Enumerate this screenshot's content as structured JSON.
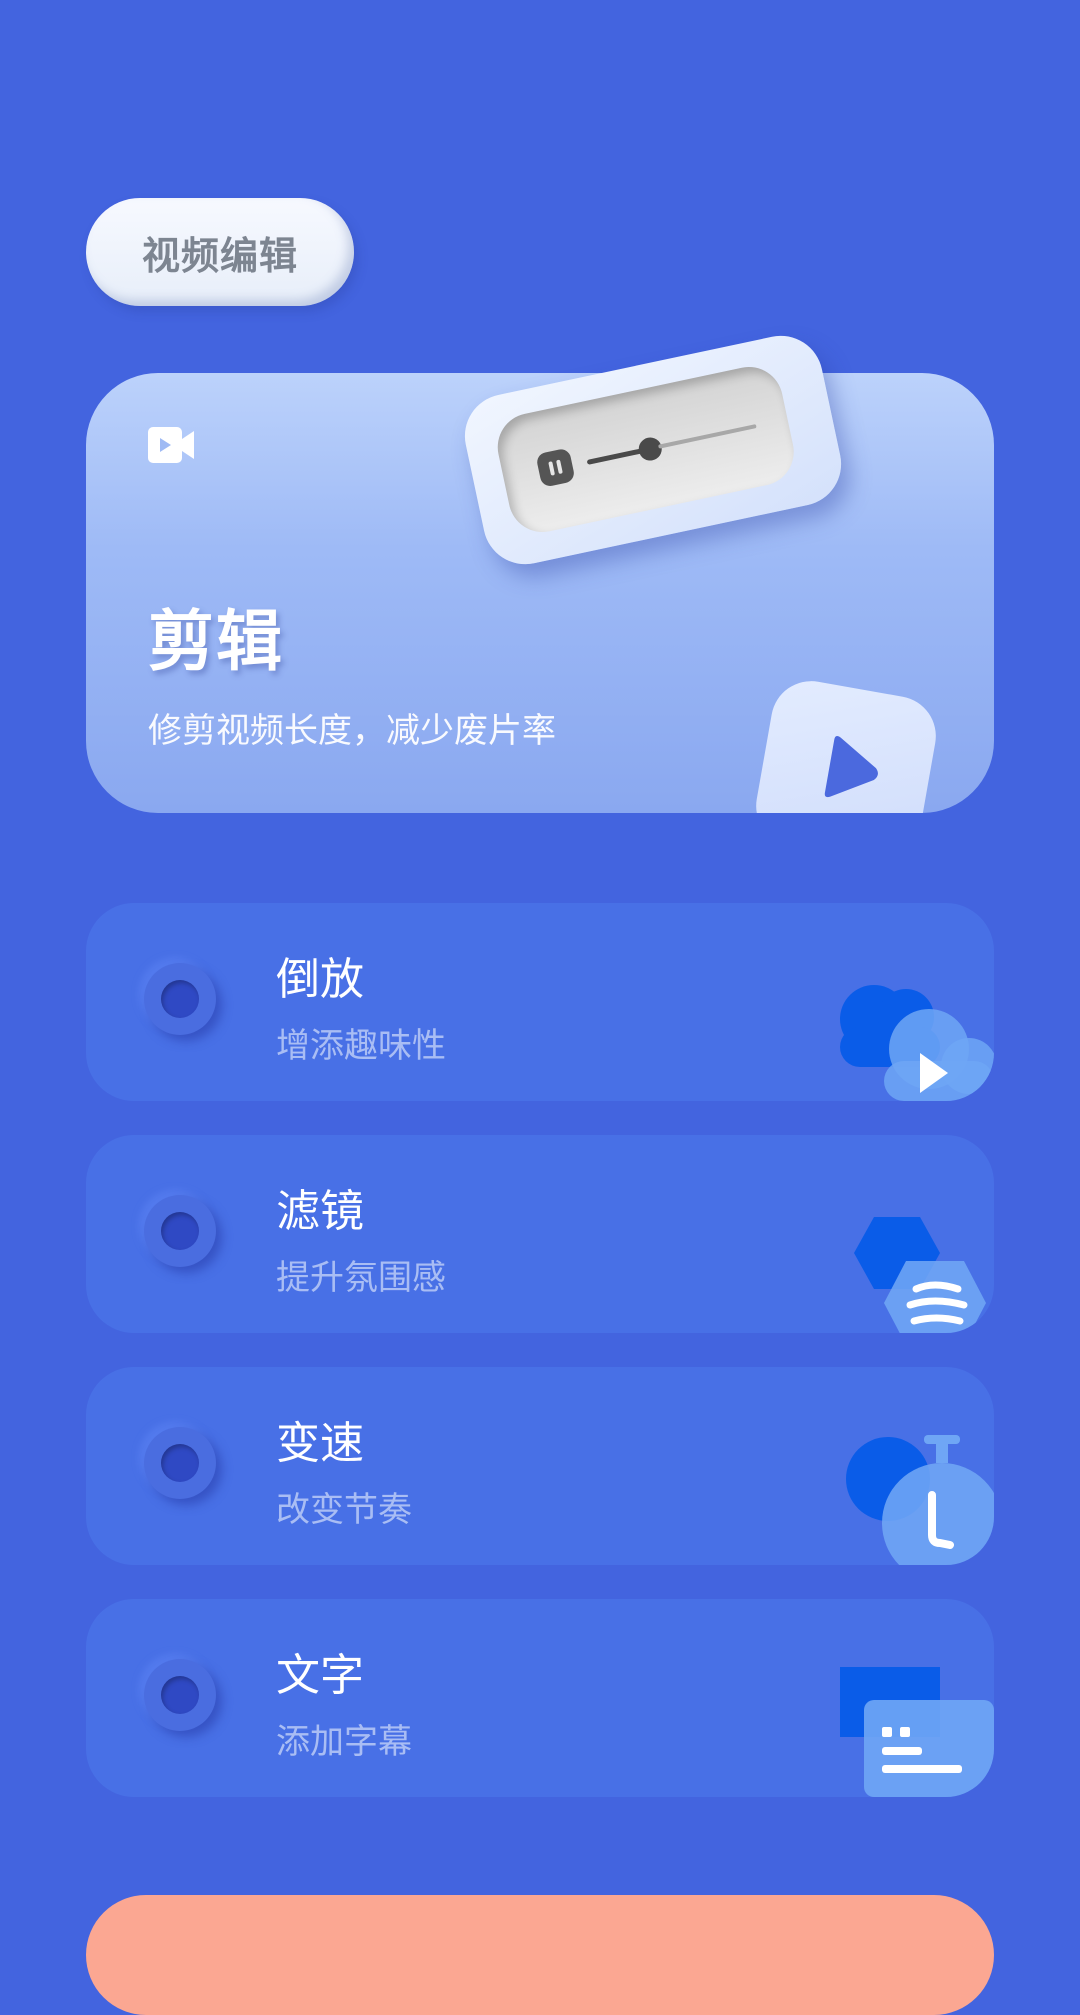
{
  "header": {
    "category_label": "视频编辑"
  },
  "hero": {
    "title": "剪辑",
    "subtitle": "修剪视频长度，减少废片率",
    "icon": "video-camera-icon"
  },
  "features": [
    {
      "title": "倒放",
      "subtitle": "增添趣味性",
      "icon": "cloud-play-icon"
    },
    {
      "title": "滤镜",
      "subtitle": "提升氛围感",
      "icon": "hexagon-filter-icon"
    },
    {
      "title": "变速",
      "subtitle": "改变节奏",
      "icon": "stopwatch-icon"
    },
    {
      "title": "文字",
      "subtitle": "添加字幕",
      "icon": "subtitle-text-icon"
    }
  ],
  "colors": {
    "background": "#4364df",
    "card": "#4870e6",
    "accent_button": "#fba792"
  }
}
